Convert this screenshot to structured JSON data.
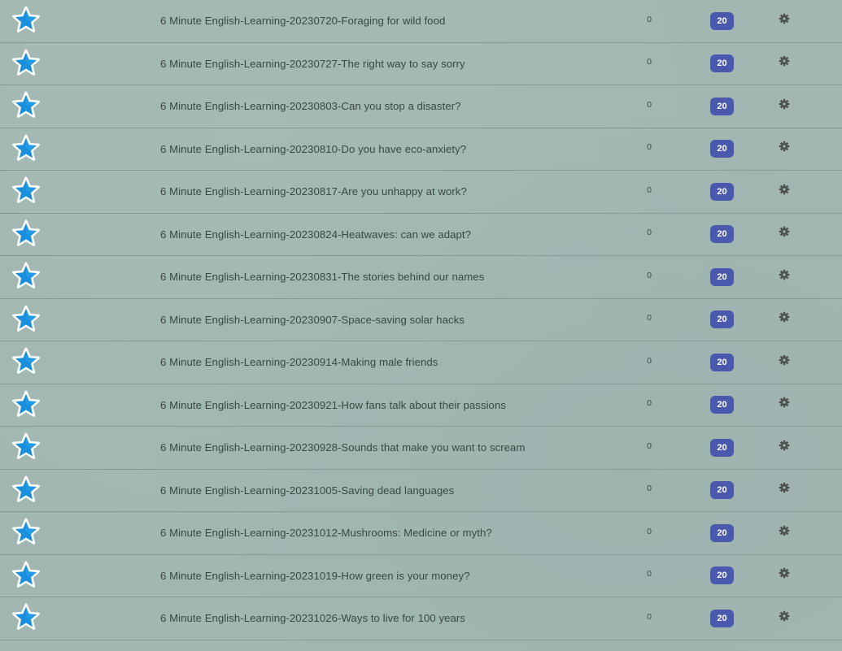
{
  "decks": [
    {
      "title": "6 Minute English-Learning-20230720-Foraging for wild food",
      "new_count": "0",
      "due_count": "20"
    },
    {
      "title": "6 Minute English-Learning-20230727-The right way to say sorry",
      "new_count": "0",
      "due_count": "20"
    },
    {
      "title": "6 Minute English-Learning-20230803-Can you stop a disaster?",
      "new_count": "0",
      "due_count": "20"
    },
    {
      "title": "6 Minute English-Learning-20230810-Do you have eco-anxiety?",
      "new_count": "0",
      "due_count": "20"
    },
    {
      "title": "6 Minute English-Learning-20230817-Are you unhappy at work?",
      "new_count": "0",
      "due_count": "20"
    },
    {
      "title": "6 Minute English-Learning-20230824-Heatwaves: can we adapt?",
      "new_count": "0",
      "due_count": "20"
    },
    {
      "title": "6 Minute English-Learning-20230831-The stories behind our names",
      "new_count": "0",
      "due_count": "20"
    },
    {
      "title": "6 Minute English-Learning-20230907-Space-saving solar hacks",
      "new_count": "0",
      "due_count": "20"
    },
    {
      "title": "6 Minute English-Learning-20230914-Making male friends",
      "new_count": "0",
      "due_count": "20"
    },
    {
      "title": "6 Minute English-Learning-20230921-How fans talk about their passions",
      "new_count": "0",
      "due_count": "20"
    },
    {
      "title": "6 Minute English-Learning-20230928-Sounds that make you want to scream",
      "new_count": "0",
      "due_count": "20"
    },
    {
      "title": "6 Minute English-Learning-20231005-Saving dead languages",
      "new_count": "0",
      "due_count": "20"
    },
    {
      "title": "6 Minute English-Learning-20231012-Mushrooms: Medicine or myth?",
      "new_count": "0",
      "due_count": "20"
    },
    {
      "title": "6 Minute English-Learning-20231019-How green is your money?",
      "new_count": "0",
      "due_count": "20"
    },
    {
      "title": "6 Minute English-Learning-20231026-Ways to live for 100 years",
      "new_count": "0",
      "due_count": "20"
    }
  ],
  "icons": {
    "star": "star-icon",
    "gear": "gear-icon"
  },
  "colors": {
    "star_fill": "#1a8fdc",
    "star_outline": "#ffffff",
    "badge_bg": "#4a58ad",
    "badge_text": "#ffffff",
    "row_bg": "#a2b7b2",
    "row_divider": "#879a96",
    "text": "#3a4744",
    "gear": "#4a4f4e"
  }
}
